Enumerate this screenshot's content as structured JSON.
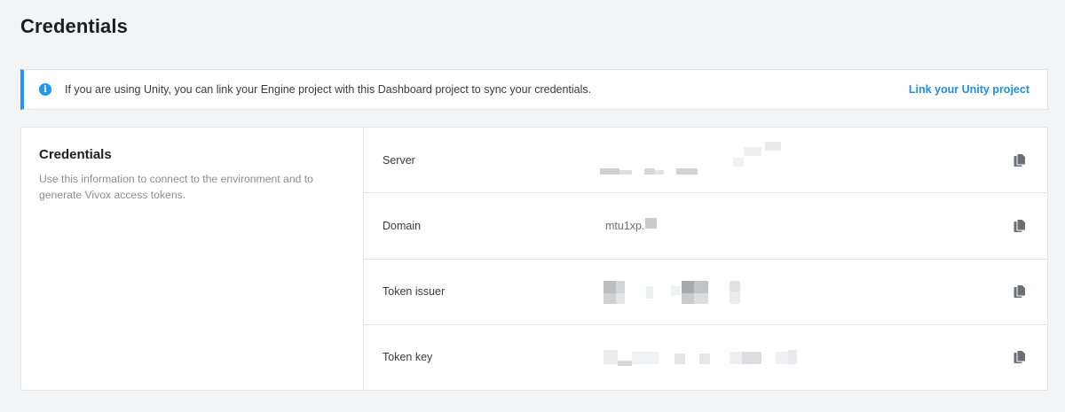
{
  "page": {
    "title": "Credentials"
  },
  "banner": {
    "text": "If you are using Unity, you can link your Engine project with this Dashboard project to sync your credentials.",
    "link_label": "Link your Unity project",
    "accent": "#2196f3"
  },
  "card": {
    "title": "Credentials",
    "description": "Use this information to connect to the environment and to generate Vivox access tokens.",
    "rows": [
      {
        "label": "Server",
        "value": "",
        "icon": "copy-icon"
      },
      {
        "label": "Domain",
        "value": "mtu1xp.",
        "icon": "copy-icon"
      },
      {
        "label": "Token issuer",
        "value": "",
        "icon": "copy-icon"
      },
      {
        "label": "Token key",
        "value": "",
        "icon": "copy-icon"
      }
    ]
  }
}
